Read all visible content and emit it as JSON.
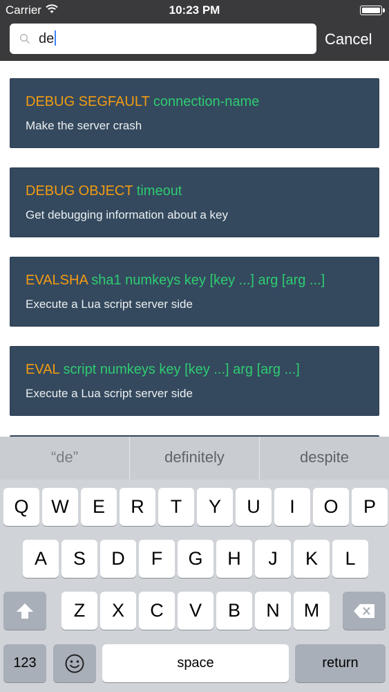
{
  "status_bar": {
    "carrier": "Carrier",
    "time": "10:23 PM"
  },
  "search": {
    "value": "de",
    "cancel_label": "Cancel"
  },
  "results": [
    {
      "command": "DEBUG SEGFAULT",
      "args": "connection-name",
      "description": "Make the server crash"
    },
    {
      "command": "DEBUG OBJECT",
      "args": "timeout",
      "description": "Get debugging information about a key"
    },
    {
      "command": "EVALSHA",
      "args": "sha1 numkeys key [key ...] arg [arg ...]",
      "description": "Execute a Lua script server side"
    },
    {
      "command": "EVAL",
      "args": "script numkeys key [key ...] arg [arg ...]",
      "description": "Execute a Lua script server side"
    }
  ],
  "keyboard": {
    "suggestions": [
      "“de”",
      "definitely",
      "despite"
    ],
    "row1": [
      "Q",
      "W",
      "E",
      "R",
      "T",
      "Y",
      "U",
      "I",
      "O",
      "P"
    ],
    "row2": [
      "A",
      "S",
      "D",
      "F",
      "G",
      "H",
      "J",
      "K",
      "L"
    ],
    "row3": [
      "Z",
      "X",
      "C",
      "V",
      "B",
      "N",
      "M"
    ],
    "numbers_label": "123",
    "space_label": "space",
    "return_label": "return"
  },
  "colors": {
    "command": "#f39c12",
    "args": "#2ecc71",
    "card_bg": "#34495e"
  }
}
